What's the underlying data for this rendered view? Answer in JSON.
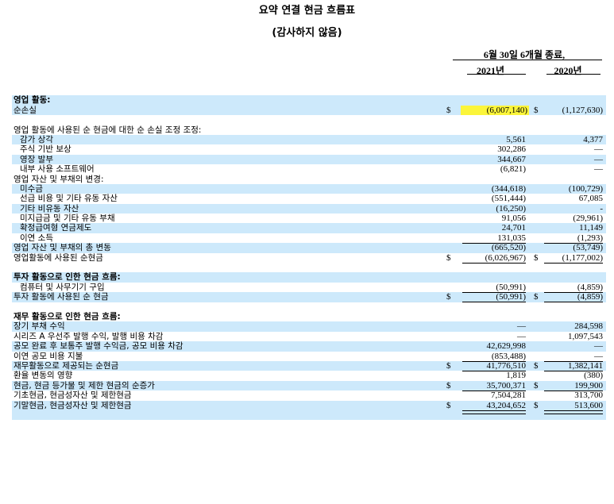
{
  "title": "요약 연결 현금 흐름표",
  "subtitle": "(감사하지 않음)",
  "header": {
    "period": "6월 30일 6개월 종료,",
    "col1": "2021년",
    "col2": "2020년"
  },
  "rows": [
    {
      "label": "",
      "v1": "",
      "v2": "",
      "d1": "",
      "d2": ""
    },
    {
      "label": "영업 활동:",
      "v1": "",
      "v2": "",
      "d1": "",
      "d2": ""
    },
    {
      "label": "순손실",
      "d1": "$",
      "v1": "(6,007,140)",
      "d2": "$",
      "v2": "(1,127,630)"
    },
    {
      "label": "",
      "v1": "",
      "v2": "",
      "d1": "",
      "d2": ""
    },
    {
      "label": "영업 활동에 사용된 순 현금에 대한 순 손실 조정 조정:",
      "v1": "",
      "v2": "",
      "d1": "",
      "d2": ""
    },
    {
      "label": "감가 상각",
      "d1": "",
      "v1": "5,561",
      "d2": "",
      "v2": "4,377"
    },
    {
      "label": "주식 기반 보상",
      "d1": "",
      "v1": "302,286",
      "d2": "",
      "v2": "—"
    },
    {
      "label": "영장 발부",
      "d1": "",
      "v1": "344,667",
      "d2": "",
      "v2": "—"
    },
    {
      "label": "내부 사용 소프트웨어",
      "d1": "",
      "v1": "(6,821)",
      "d2": "",
      "v2": "—"
    },
    {
      "label": "영업 자산 및 부채의 변경:",
      "v1": "",
      "v2": "",
      "d1": "",
      "d2": ""
    },
    {
      "label": "미수금",
      "d1": "",
      "v1": "(344,618)",
      "d2": "",
      "v2": "(100,729)"
    },
    {
      "label": "선급 비용 및 기타 유동 자산",
      "d1": "",
      "v1": "(551,444)",
      "d2": "",
      "v2": "67,085"
    },
    {
      "label": "기타 비유동 자산",
      "d1": "",
      "v1": "(16,250)",
      "d2": "",
      "v2": "-"
    },
    {
      "label": "미지급금 및 기타 유동 부채",
      "d1": "",
      "v1": "91,056",
      "d2": "",
      "v2": "(29,961)"
    },
    {
      "label": "확정급여형 연금제도",
      "d1": "",
      "v1": "24,701",
      "d2": "",
      "v2": "11,149"
    },
    {
      "label": "이연 소득",
      "d1": "",
      "v1": "131,035",
      "d2": "",
      "v2": "(1,293)"
    },
    {
      "label": "영업 자산 및 부채의 총 변동",
      "d1": "",
      "v1": "(665,520)",
      "d2": "",
      "v2": "(53,749)"
    },
    {
      "label": "영업활동에 사용된 순현금",
      "d1": "$",
      "v1": "(6,026,967)",
      "d2": "$",
      "v2": "(1,177,002)"
    },
    {
      "label": "",
      "v1": "",
      "v2": "",
      "d1": "",
      "d2": ""
    },
    {
      "label": "투자 활동으로 인한 현금 흐름:",
      "v1": "",
      "v2": "",
      "d1": "",
      "d2": ""
    },
    {
      "label": "컴퓨터 및 사무기기 구입",
      "d1": "",
      "v1": "(50,991)",
      "d2": "",
      "v2": "(4,859)"
    },
    {
      "label": "투자 활동에 사용된 순 현금",
      "d1": "$",
      "v1": "(50,991)",
      "d2": "$",
      "v2": "(4,859)"
    },
    {
      "label": "",
      "v1": "",
      "v2": "",
      "d1": "",
      "d2": ""
    },
    {
      "label": "재무 활동으로 인한 현금 흐름:",
      "v1": "",
      "v2": "",
      "d1": "",
      "d2": ""
    },
    {
      "label": "장기 부채 수익",
      "d1": "",
      "v1": "—",
      "d2": "",
      "v2": "284,598"
    },
    {
      "label": "시리즈 A 우선주 발행 수익, 발행 비용 차감",
      "d1": "",
      "v1": "—",
      "d2": "",
      "v2": "1,097,543"
    },
    {
      "label": "공모 완료 후 보통주 발행 수익금, 공모 비용 차감",
      "d1": "",
      "v1": "42,629,998",
      "d2": "",
      "v2": "—"
    },
    {
      "label": "이연 공모 비용 지불",
      "d1": "",
      "v1": "(853,488)",
      "d2": "",
      "v2": "—"
    },
    {
      "label": "재무활동으로 제공되는 순현금",
      "d1": "$",
      "v1": "41,776,510",
      "d2": "$",
      "v2": "1,382,141"
    },
    {
      "label": "환율 변동의 영향",
      "d1": "",
      "v1": "1,819",
      "d2": "",
      "v2": "(380)"
    },
    {
      "label": "현금, 현금 등가물 및 제한 현금의 순증가",
      "d1": "$",
      "v1": "35,700,371",
      "d2": "$",
      "v2": "199,900"
    },
    {
      "label": "기초현금, 현금성자산 및 제한현금",
      "d1": "",
      "v1": "7,504,281",
      "d2": "",
      "v2": "313,700"
    },
    {
      "label": "기말현금, 현금성자산 및 제한현금",
      "d1": "$",
      "v1": "43,204,652",
      "d2": "$",
      "v2": "513,600"
    },
    {
      "label": "",
      "v1": "",
      "v2": "",
      "d1": "",
      "d2": ""
    }
  ],
  "colors": {
    "row_shade": "#cde9fb",
    "highlight": "#fbf53a"
  }
}
